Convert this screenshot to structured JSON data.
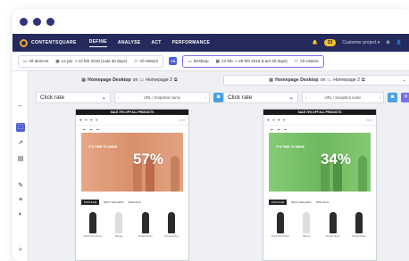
{
  "nav": {
    "brand": "CONTENTSQUARE",
    "items": [
      "DEFINE",
      "ANALYSE",
      "ACT",
      "PERFORMANCE"
    ],
    "notification_count": "23",
    "project": "Customer project"
  },
  "filters": {
    "left": {
      "device": "All devices",
      "date": "12 jan ⇢ 12 feb 2019 (Last 30 days)",
      "visitors": "All visitors"
    },
    "vs": "VS",
    "right": {
      "device": "Desktop",
      "date": "13 feb ⇢ 29 feb 2019 (Last 30 days)",
      "visitors": "All visitors"
    }
  },
  "left_pane": {
    "heading_pre": "Homepage Desktop",
    "heading_on": "on",
    "heading_page": "Homepage 2",
    "metric": "Click rate",
    "snapshot": "URL / Snapshot name",
    "banner": "SALE 70% OFF ALL PRODUCTS",
    "hero_text": "IT'S TIME TO SHINE",
    "percent": "57%",
    "tabs": [
      "POPULAR",
      "BEST SELLERS",
      "SPECIALS"
    ],
    "products": [
      "Floral Print Dress",
      "Blouse",
      "Printed Dress",
      "Printed Dress"
    ]
  },
  "right_pane": {
    "heading_pre": "Homepage Desktop",
    "heading_on": "on",
    "heading_page": "Homepage 2",
    "metric": "Click rate",
    "snapshot": "URL / Snapshot name",
    "banner": "SALE 70% OFF ALL PRODUCTS",
    "hero_text": "IT'S TIME TO SHINE",
    "percent": "34%",
    "tabs": [
      "POPULAR",
      "BEST SELLERS",
      "SPECIALS"
    ],
    "products": [
      "Floral Print Dress",
      "Blouse",
      "Printed Dress",
      "Printed Dress"
    ]
  },
  "colors": {
    "nav_bg": "#252a5c",
    "accent": "#4d5fd6",
    "left_heat": "#e39a78",
    "right_heat": "#78c56a"
  }
}
